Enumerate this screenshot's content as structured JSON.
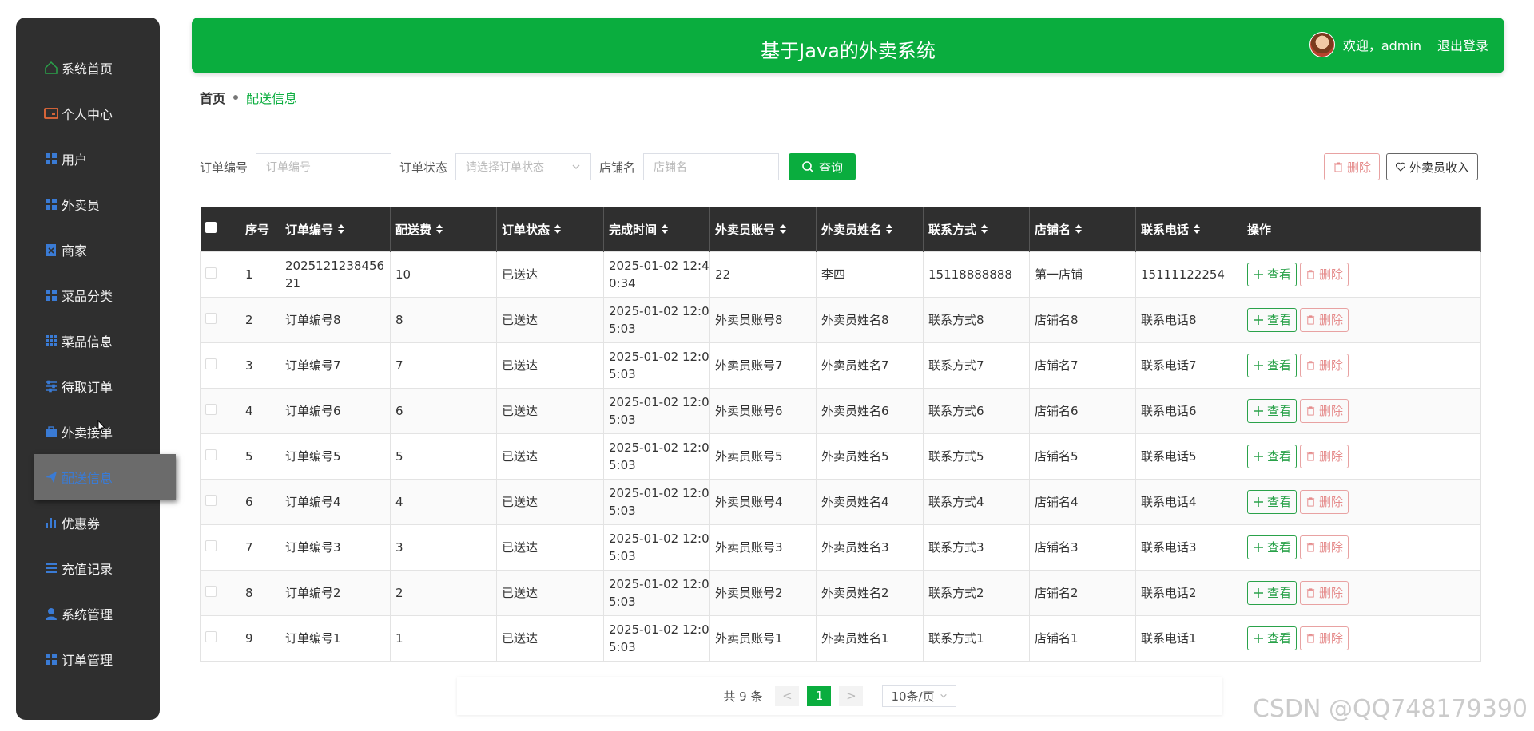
{
  "sidebar": {
    "items": [
      {
        "label": "系统首页",
        "icon": "home-icon"
      },
      {
        "label": "个人中心",
        "icon": "user-card-icon"
      },
      {
        "label": "用户",
        "icon": "grid-icon"
      },
      {
        "label": "外卖员",
        "icon": "grid-icon"
      },
      {
        "label": "商家",
        "icon": "clipboard-icon"
      },
      {
        "label": "菜品分类",
        "icon": "grid-icon"
      },
      {
        "label": "菜品信息",
        "icon": "grid-9-icon"
      },
      {
        "label": "待取订单",
        "icon": "sliders-icon"
      },
      {
        "label": "外卖接单",
        "icon": "briefcase-icon"
      },
      {
        "label": "配送信息",
        "icon": "send-icon"
      },
      {
        "label": "优惠券",
        "icon": "bar-chart-icon"
      },
      {
        "label": "充值记录",
        "icon": "list-icon"
      },
      {
        "label": "系统管理",
        "icon": "person-icon"
      },
      {
        "label": "订单管理",
        "icon": "grid-icon"
      }
    ],
    "active_index": 9
  },
  "header": {
    "title": "基于Java的外卖系统",
    "welcome": "欢迎，admin",
    "logout": "退出登录"
  },
  "breadcrumb": {
    "home": "首页",
    "current": "配送信息"
  },
  "search": {
    "order_no_label": "订单编号",
    "order_no_placeholder": "订单编号",
    "status_label": "订单状态",
    "status_placeholder": "请选择订单状态",
    "shop_label": "店铺名",
    "shop_placeholder": "店铺名",
    "query_button": "查询"
  },
  "actions": {
    "delete": "删除",
    "rider_income": "外卖员收入"
  },
  "table": {
    "columns": [
      "序号",
      "订单编号",
      "配送费",
      "订单状态",
      "完成时间",
      "外卖员账号",
      "外卖员姓名",
      "联系方式",
      "店铺名",
      "联系电话",
      "操作"
    ],
    "view_label": "查看",
    "delete_label": "删除",
    "rows": [
      [
        "1",
        "202512123845621",
        "10",
        "已送达",
        "2025-01-02 12:40:34",
        "22",
        "李四",
        "15118888888",
        "第一店铺",
        "15111122254"
      ],
      [
        "2",
        "订单编号8",
        "8",
        "已送达",
        "2025-01-02 12:05:03",
        "外卖员账号8",
        "外卖员姓名8",
        "联系方式8",
        "店铺名8",
        "联系电话8"
      ],
      [
        "3",
        "订单编号7",
        "7",
        "已送达",
        "2025-01-02 12:05:03",
        "外卖员账号7",
        "外卖员姓名7",
        "联系方式7",
        "店铺名7",
        "联系电话7"
      ],
      [
        "4",
        "订单编号6",
        "6",
        "已送达",
        "2025-01-02 12:05:03",
        "外卖员账号6",
        "外卖员姓名6",
        "联系方式6",
        "店铺名6",
        "联系电话6"
      ],
      [
        "5",
        "订单编号5",
        "5",
        "已送达",
        "2025-01-02 12:05:03",
        "外卖员账号5",
        "外卖员姓名5",
        "联系方式5",
        "店铺名5",
        "联系电话5"
      ],
      [
        "6",
        "订单编号4",
        "4",
        "已送达",
        "2025-01-02 12:05:03",
        "外卖员账号4",
        "外卖员姓名4",
        "联系方式4",
        "店铺名4",
        "联系电话4"
      ],
      [
        "7",
        "订单编号3",
        "3",
        "已送达",
        "2025-01-02 12:05:03",
        "外卖员账号3",
        "外卖员姓名3",
        "联系方式3",
        "店铺名3",
        "联系电话3"
      ],
      [
        "8",
        "订单编号2",
        "2",
        "已送达",
        "2025-01-02 12:05:03",
        "外卖员账号2",
        "外卖员姓名2",
        "联系方式2",
        "店铺名2",
        "联系电话2"
      ],
      [
        "9",
        "订单编号1",
        "1",
        "已送达",
        "2025-01-02 12:05:03",
        "外卖员账号1",
        "外卖员姓名1",
        "联系方式1",
        "店铺名1",
        "联系电话1"
      ]
    ]
  },
  "pagination": {
    "total": "共 9 条",
    "prev": "<",
    "current": "1",
    "next": ">",
    "page_size": "10条/页"
  },
  "watermark": "CSDN @QQ748179390",
  "colors": {
    "primary": "#0aad3e",
    "sidebar_bg": "#2f2f2f",
    "danger": "#e58b8b"
  }
}
